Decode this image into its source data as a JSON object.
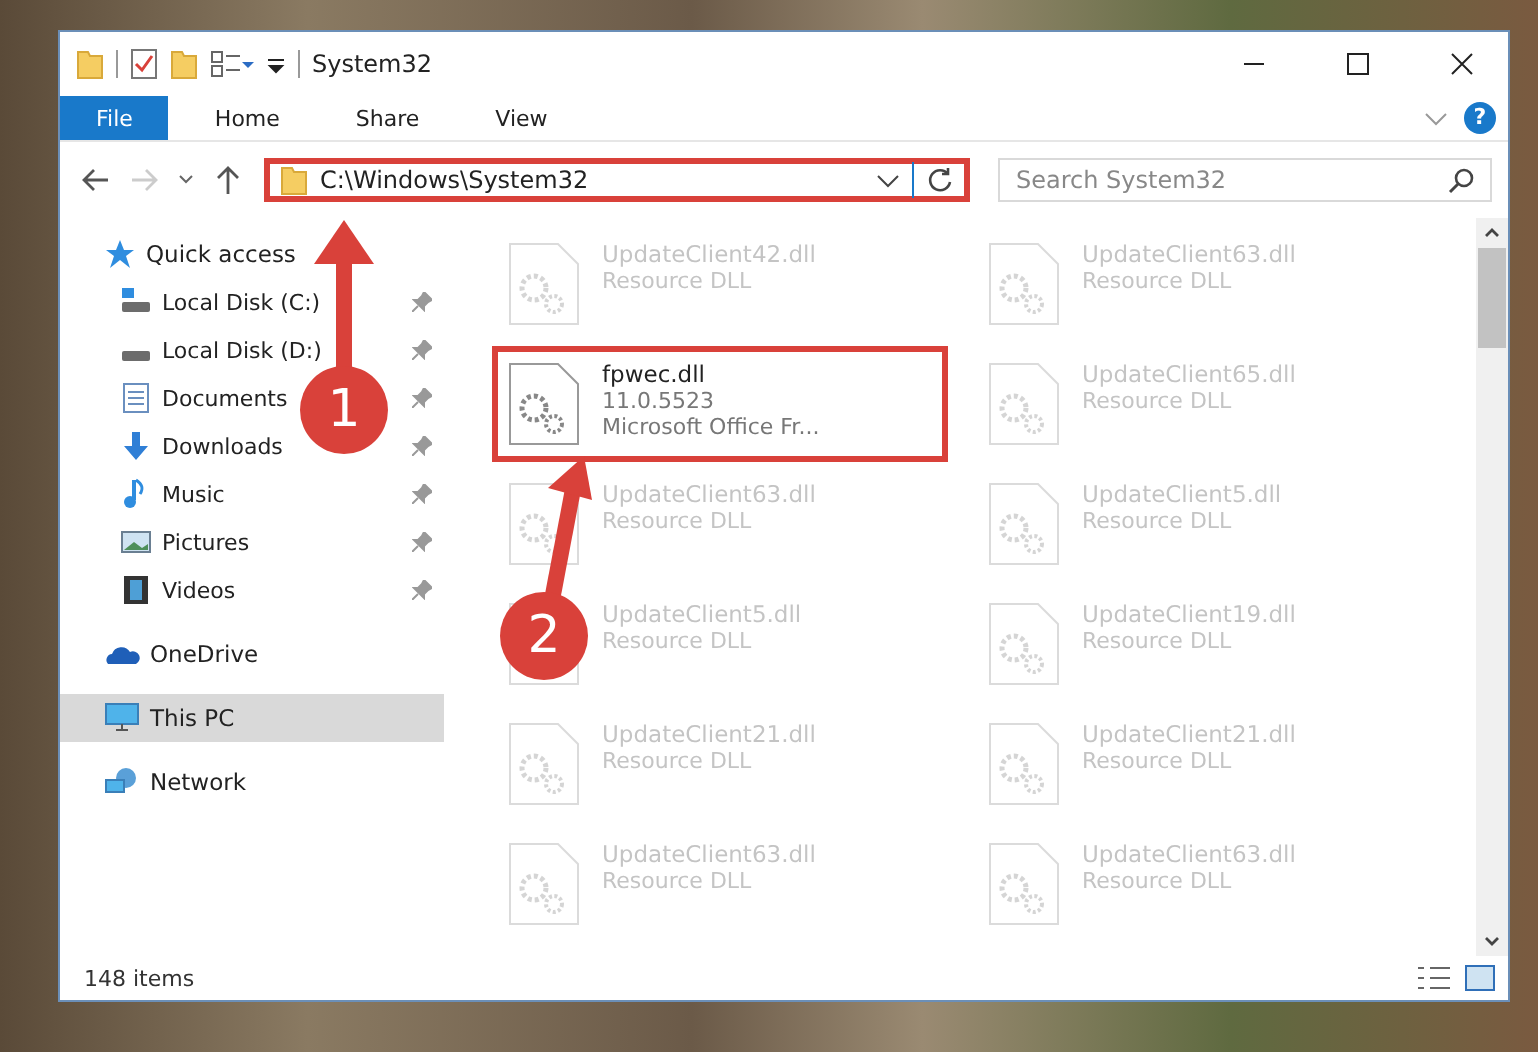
{
  "window": {
    "title": "System32"
  },
  "ribbon": {
    "tabs": [
      {
        "label": "File",
        "selected": true
      },
      {
        "label": "Home",
        "selected": false
      },
      {
        "label": "Share",
        "selected": false
      },
      {
        "label": "View",
        "selected": false
      }
    ],
    "help": "?"
  },
  "address": {
    "path": "C:\\Windows\\System32",
    "highlighted": true
  },
  "search": {
    "placeholder": "Search System32"
  },
  "sidebar": {
    "items": [
      {
        "label": "Quick access",
        "kind": "star",
        "selected": false,
        "children": [
          {
            "label": "Local Disk (C:)",
            "kind": "drive-c",
            "pinned": true,
            "selected": false
          },
          {
            "label": "Local Disk (D:)",
            "kind": "drive",
            "pinned": true,
            "selected": false
          },
          {
            "label": "Documents",
            "kind": "documents",
            "pinned": true,
            "selected": false
          },
          {
            "label": "Downloads",
            "kind": "downloads",
            "pinned": true,
            "selected": false
          },
          {
            "label": "Music",
            "kind": "music",
            "pinned": true,
            "selected": false
          },
          {
            "label": "Pictures",
            "kind": "pictures",
            "pinned": true,
            "selected": false
          },
          {
            "label": "Videos",
            "kind": "videos",
            "pinned": true,
            "selected": false
          }
        ]
      },
      {
        "label": "OneDrive",
        "kind": "cloud",
        "selected": false
      },
      {
        "label": "This PC",
        "kind": "pc",
        "selected": true
      },
      {
        "label": "Network",
        "kind": "network",
        "selected": false
      }
    ]
  },
  "files": [
    {
      "name": "UpdateClient42.dll",
      "details": [
        "Resource DLL"
      ],
      "faded": true,
      "highlighted": false
    },
    {
      "name": "UpdateClient63.dll",
      "details": [
        "Resource DLL"
      ],
      "faded": true,
      "highlighted": false
    },
    {
      "name": "fpwec.dll",
      "details": [
        "11.0.5523",
        "Microsoft Office Fr..."
      ],
      "faded": false,
      "highlighted": true
    },
    {
      "name": "UpdateClient65.dll",
      "details": [
        "Resource DLL"
      ],
      "faded": true,
      "highlighted": false
    },
    {
      "name": "UpdateClient63.dll",
      "details": [
        "Resource DLL"
      ],
      "faded": true,
      "highlighted": false
    },
    {
      "name": "UpdateClient5.dll",
      "details": [
        "Resource DLL"
      ],
      "faded": true,
      "highlighted": false
    },
    {
      "name": "UpdateClient5.dll",
      "details": [
        "Resource DLL"
      ],
      "faded": true,
      "highlighted": false
    },
    {
      "name": "UpdateClient19.dll",
      "details": [
        "Resource DLL"
      ],
      "faded": true,
      "highlighted": false
    },
    {
      "name": "UpdateClient21.dll",
      "details": [
        "Resource DLL"
      ],
      "faded": true,
      "highlighted": false
    },
    {
      "name": "UpdateClient21.dll",
      "details": [
        "Resource DLL"
      ],
      "faded": true,
      "highlighted": false
    },
    {
      "name": "UpdateClient63.dll",
      "details": [
        "Resource DLL"
      ],
      "faded": true,
      "highlighted": false
    },
    {
      "name": "UpdateClient63.dll",
      "details": [
        "Resource DLL"
      ],
      "faded": true,
      "highlighted": false
    }
  ],
  "status_bar": {
    "count": "148 items"
  },
  "annotations": [
    {
      "label": "1"
    },
    {
      "label": "2"
    }
  ]
}
